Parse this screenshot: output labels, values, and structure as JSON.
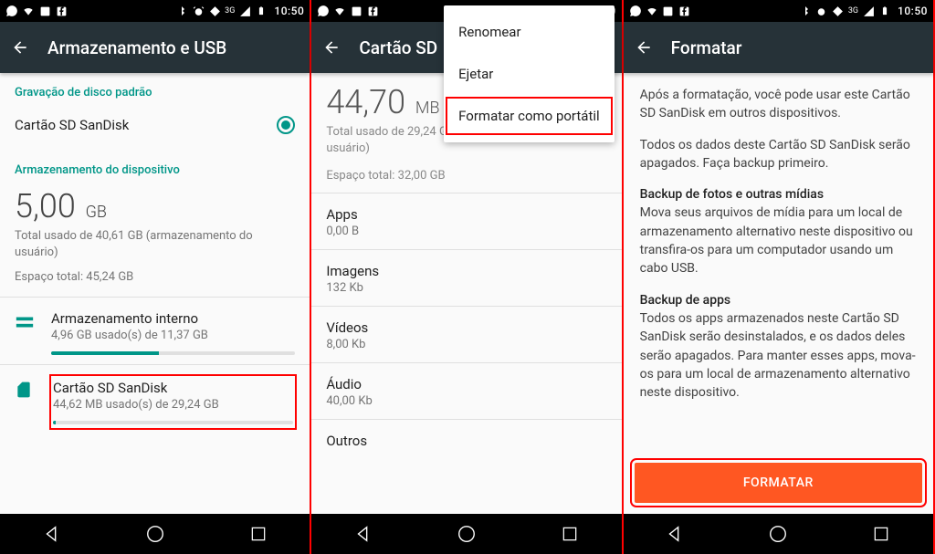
{
  "status": {
    "time": "10:50",
    "network": "3G"
  },
  "screen1": {
    "title": "Armazenamento e USB",
    "section_default": "Gravação de disco padrão",
    "default_option": "Cartão SD SanDisk",
    "section_device": "Armazenamento do dispositivo",
    "usage_value": "5,00",
    "usage_unit": "GB",
    "usage_sub": "Total usado de 40,61 GB (armazenamento do usuário)",
    "usage_total": "Espaço total: 45,24 GB",
    "internal": {
      "title": "Armazenamento interno",
      "sub": "4,96 GB usado(s) de 11,37 GB",
      "pct": 44
    },
    "sdcard": {
      "title": "Cartão SD SanDisk",
      "sub": "44,62 MB usado(s) de 29,24 GB",
      "pct": 1
    }
  },
  "screen2": {
    "title": "Cartão SD",
    "usage_value": "44,70",
    "usage_unit": "MB",
    "usage_sub": "Total usado de 29,24 GB (armazenamento do usuário)",
    "usage_total": "Espaço total: 32,00 GB",
    "menu": {
      "rename": "Renomear",
      "eject": "Ejetar",
      "format": "Formatar como portátil"
    },
    "categories": [
      {
        "title": "Apps",
        "value": "0,00 B"
      },
      {
        "title": "Imagens",
        "value": "132 Kb"
      },
      {
        "title": "Vídeos",
        "value": "8,00 Kb"
      },
      {
        "title": "Áudio",
        "value": "40,00 Kb"
      },
      {
        "title": "Outros",
        "value": ""
      }
    ]
  },
  "screen3": {
    "title": "Formatar",
    "p1": "Após a formatação, você pode usar este Cartão SD SanDisk em outros dispositivos.",
    "p2": "Todos os dados deste Cartão SD SanDisk serão apagados. Faça backup primeiro.",
    "h1": "Backup de fotos e outras mídias",
    "p3": "Mova seus arquivos de mídia para um local de armazenamento alternativo neste dispositivo ou transfira-os para um computador usando um cabo USB.",
    "h2": "Backup de apps",
    "p4": "Todos os apps armazenados neste Cartão SD SanDisk serão desinstalados, e os dados deles serão apagados. Para manter esses apps, mova-os para um local de armazenamento alternativo neste dispositivo.",
    "button": "FORMATAR"
  }
}
